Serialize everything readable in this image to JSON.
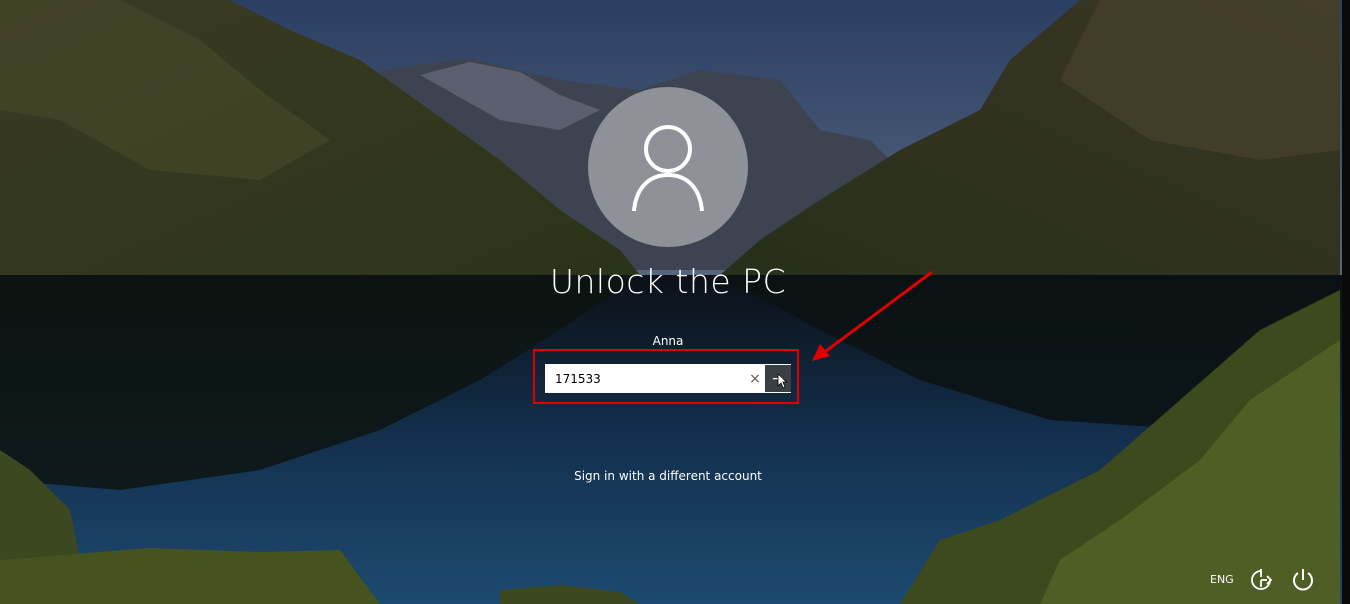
{
  "lock_screen": {
    "title": "Unlock the PC",
    "username": "Anna",
    "password_value": "171533",
    "clear_glyph": "×",
    "submit_glyph": "→",
    "different_account_label": "Sign in with a different account",
    "language": "ENG"
  },
  "icons": {
    "avatar": "user-silhouette-icon",
    "clear": "close-icon",
    "submit": "arrow-right-icon",
    "ease_of_access": "ease-of-access-icon",
    "power": "power-icon",
    "annotation": "red-arrow-annotation"
  },
  "colors": {
    "annotation_red": "#e00000",
    "submit_bg": "#3a3f46",
    "avatar_bg": "rgba(210,210,210,0.55)"
  }
}
